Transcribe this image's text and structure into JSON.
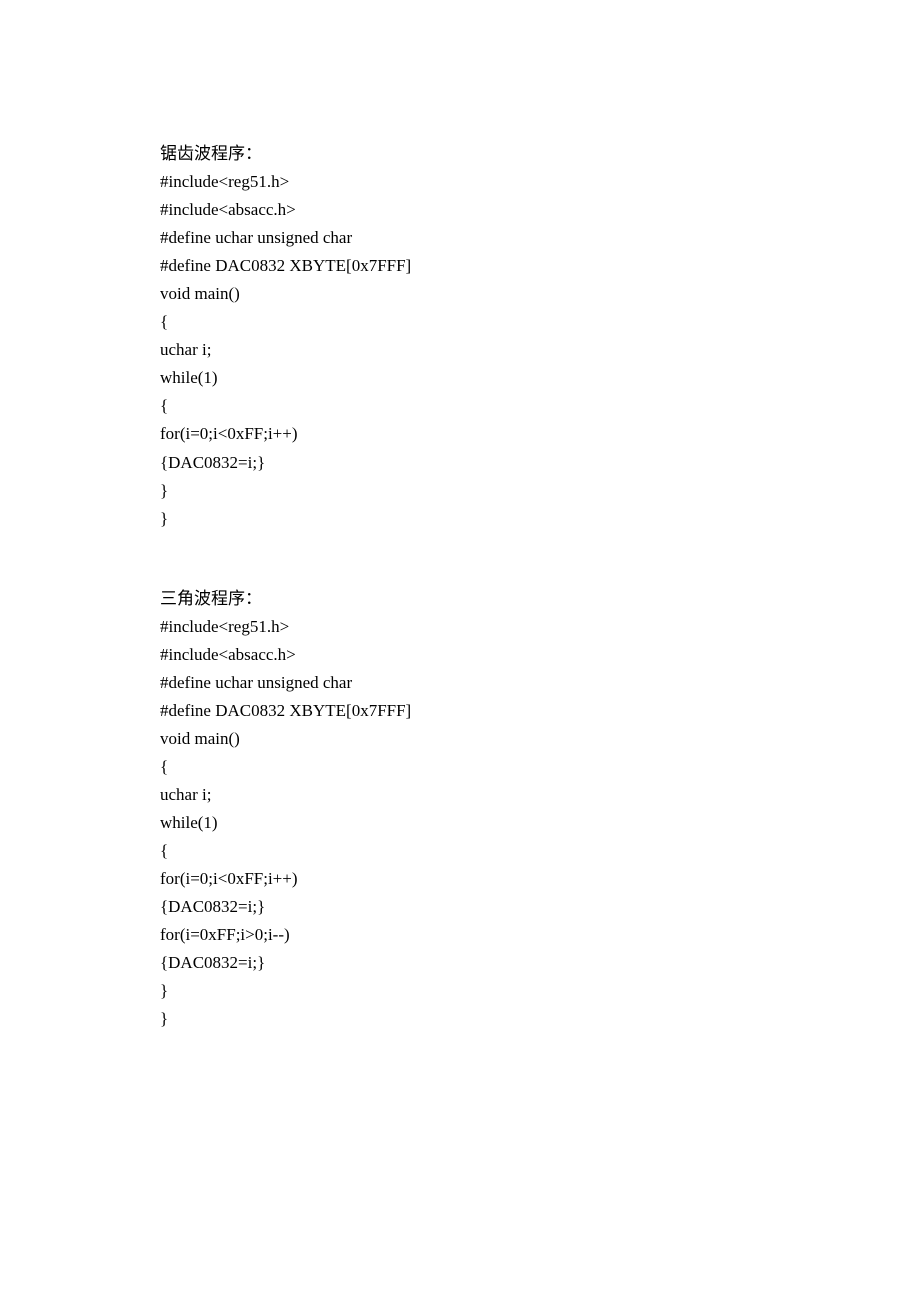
{
  "block1": {
    "title": "锯齿波程序：",
    "lines": [
      "#include<reg51.h>",
      "#include<absacc.h>",
      "#define uchar unsigned char",
      "#define DAC0832 XBYTE[0x7FFF]",
      "void main()",
      "{",
      "uchar i;",
      "while(1)",
      "{",
      "for(i=0;i<0xFF;i++)",
      "{DAC0832=i;}",
      "}",
      "}"
    ]
  },
  "block2": {
    "title": "三角波程序：",
    "lines": [
      "#include<reg51.h>",
      "#include<absacc.h>",
      "#define uchar unsigned char",
      "#define DAC0832 XBYTE[0x7FFF]",
      "void main()",
      "{",
      "uchar i;",
      "while(1)",
      "{",
      "for(i=0;i<0xFF;i++)",
      "{DAC0832=i;}",
      "for(i=0xFF;i>0;i--)",
      "{DAC0832=i;}",
      "}",
      "}"
    ]
  }
}
